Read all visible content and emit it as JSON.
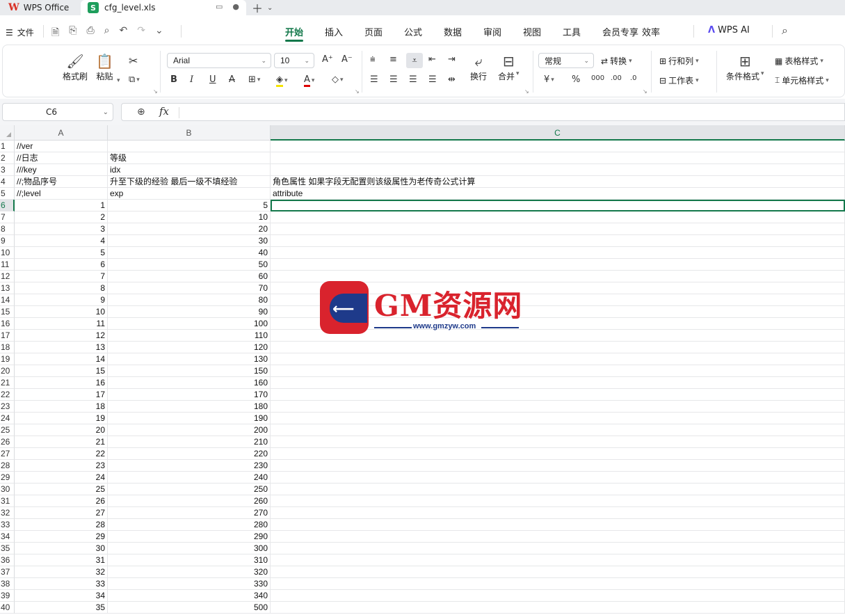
{
  "titlebar": {
    "app_tab": "WPS Office",
    "doc_tab": "cfg_level.xls",
    "doc_icon_letter": "S"
  },
  "menubar": {
    "file_label": "文件",
    "items": [
      "开始",
      "插入",
      "页面",
      "公式",
      "数据",
      "审阅",
      "视图",
      "工具",
      "会员专享",
      "效率"
    ],
    "active_item": "开始",
    "ai_label": "WPS AI"
  },
  "ribbon": {
    "format_painter": "格式刷",
    "paste": "粘贴",
    "font_name": "Arial",
    "font_size": "10",
    "wrap": "换行",
    "merge": "合并",
    "number_format": "常规",
    "convert": "转换",
    "rows_cols": "行和列",
    "worksheet": "工作表",
    "conditional_format": "条件格式",
    "table_style": "表格样式",
    "cell_style": "单元格样式",
    "bold": "B",
    "italic": "I",
    "underline": "U",
    "strike": "A",
    "currency": "¥",
    "percent": "%"
  },
  "formula_bar": {
    "name_box": "C6",
    "fx_label": "fx",
    "formula": ""
  },
  "grid": {
    "column_headers": [
      "A",
      "B",
      "C"
    ],
    "selected_column": "C",
    "selected_row": "6",
    "active_cell": "C6",
    "rows": [
      {
        "n": "1",
        "a": "//ver",
        "b": "",
        "c": ""
      },
      {
        "n": "2",
        "a": "//日志",
        "b": "等级",
        "c": ""
      },
      {
        "n": "3",
        "a": "///key",
        "b": "idx",
        "c": ""
      },
      {
        "n": "4",
        "a": "//;物品序号",
        "b": "升至下级的经验 最后一级不填经验",
        "c": "角色属性 如果字段无配置则该级属性为老传奇公式计算"
      },
      {
        "n": "5",
        "a": "//;level",
        "b": "exp",
        "c": "attribute"
      },
      {
        "n": "6",
        "a": "1",
        "b": "5",
        "c": ""
      },
      {
        "n": "7",
        "a": "2",
        "b": "10",
        "c": ""
      },
      {
        "n": "8",
        "a": "3",
        "b": "20",
        "c": ""
      },
      {
        "n": "9",
        "a": "4",
        "b": "30",
        "c": ""
      },
      {
        "n": "10",
        "a": "5",
        "b": "40",
        "c": ""
      },
      {
        "n": "11",
        "a": "6",
        "b": "50",
        "c": ""
      },
      {
        "n": "12",
        "a": "7",
        "b": "60",
        "c": ""
      },
      {
        "n": "13",
        "a": "8",
        "b": "70",
        "c": ""
      },
      {
        "n": "14",
        "a": "9",
        "b": "80",
        "c": ""
      },
      {
        "n": "15",
        "a": "10",
        "b": "90",
        "c": ""
      },
      {
        "n": "16",
        "a": "11",
        "b": "100",
        "c": ""
      },
      {
        "n": "17",
        "a": "12",
        "b": "110",
        "c": ""
      },
      {
        "n": "18",
        "a": "13",
        "b": "120",
        "c": ""
      },
      {
        "n": "19",
        "a": "14",
        "b": "130",
        "c": ""
      },
      {
        "n": "20",
        "a": "15",
        "b": "150",
        "c": ""
      },
      {
        "n": "21",
        "a": "16",
        "b": "160",
        "c": ""
      },
      {
        "n": "22",
        "a": "17",
        "b": "170",
        "c": ""
      },
      {
        "n": "23",
        "a": "18",
        "b": "180",
        "c": ""
      },
      {
        "n": "24",
        "a": "19",
        "b": "190",
        "c": ""
      },
      {
        "n": "25",
        "a": "20",
        "b": "200",
        "c": ""
      },
      {
        "n": "26",
        "a": "21",
        "b": "210",
        "c": ""
      },
      {
        "n": "27",
        "a": "22",
        "b": "220",
        "c": ""
      },
      {
        "n": "28",
        "a": "23",
        "b": "230",
        "c": ""
      },
      {
        "n": "29",
        "a": "24",
        "b": "240",
        "c": ""
      },
      {
        "n": "30",
        "a": "25",
        "b": "250",
        "c": ""
      },
      {
        "n": "31",
        "a": "26",
        "b": "260",
        "c": ""
      },
      {
        "n": "32",
        "a": "27",
        "b": "270",
        "c": ""
      },
      {
        "n": "33",
        "a": "28",
        "b": "280",
        "c": ""
      },
      {
        "n": "34",
        "a": "29",
        "b": "290",
        "c": ""
      },
      {
        "n": "35",
        "a": "30",
        "b": "300",
        "c": ""
      },
      {
        "n": "36",
        "a": "31",
        "b": "310",
        "c": ""
      },
      {
        "n": "37",
        "a": "32",
        "b": "320",
        "c": ""
      },
      {
        "n": "38",
        "a": "33",
        "b": "330",
        "c": ""
      },
      {
        "n": "39",
        "a": "34",
        "b": "340",
        "c": ""
      },
      {
        "n": "40",
        "a": "35",
        "b": "500",
        "c": ""
      }
    ]
  },
  "watermark": {
    "title": "GM资源网",
    "url": "www.gmzyw.com"
  },
  "colors": {
    "accent": "#13784b",
    "wps_red": "#d93025",
    "watermark_red": "#d9232d",
    "watermark_blue": "#1e3a8a"
  }
}
